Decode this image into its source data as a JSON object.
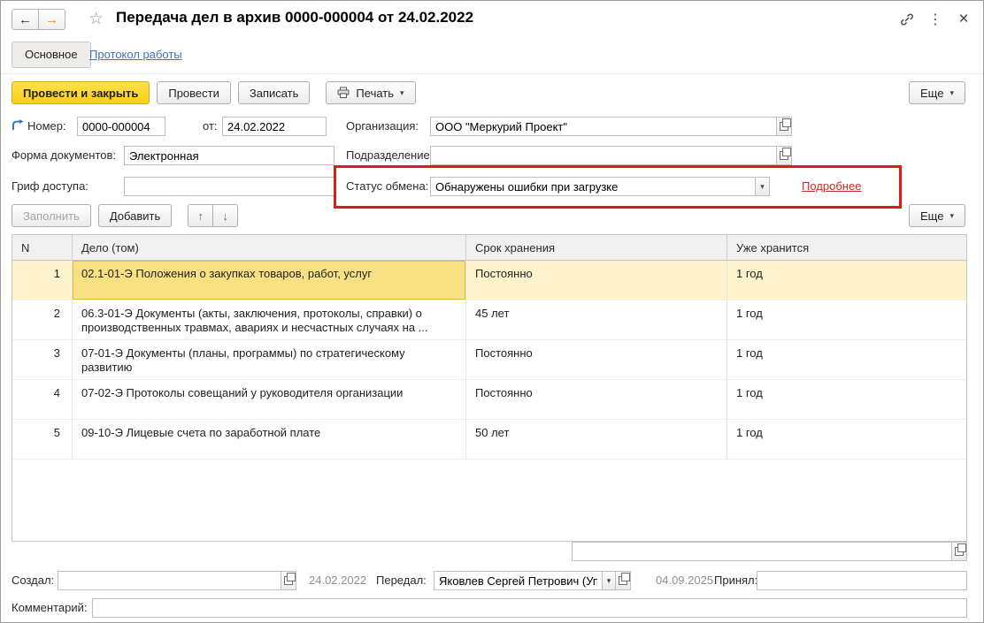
{
  "window": {
    "title": "Передача дел в архив 0000-000004 от 24.02.2022"
  },
  "icons": {
    "back": "←",
    "forward": "→",
    "star": "☆",
    "menu": "⋮",
    "close": "×",
    "caret": "▾",
    "up": "↑",
    "down": "↓"
  },
  "tabs": {
    "main": "Основное",
    "protocol": "Протокол работы"
  },
  "toolbar": {
    "post_and_close": "Провести и закрыть",
    "post": "Провести",
    "write": "Записать",
    "print": "Печать",
    "more": "Еще"
  },
  "fields": {
    "number_label": "Номер:",
    "number_value": "0000-000004",
    "from_label": "от:",
    "date_value": "24.02.2022",
    "org_label": "Организация:",
    "org_value": "ООО \"Меркурий Проект\"",
    "doc_form_label": "Форма документов:",
    "doc_form_value": "Электронная",
    "department_label": "Подразделение:",
    "department_value": "",
    "access_label": "Гриф доступа:",
    "access_value": "",
    "status_label": "Статус обмена:",
    "status_value": "Обнаружены ошибки при загрузке",
    "details_link": "Подробнее"
  },
  "table_toolbar": {
    "fill": "Заполнить",
    "add": "Добавить",
    "more": "Еще"
  },
  "table": {
    "columns": [
      "N",
      "Дело (том)",
      "Срок хранения",
      "Уже хранится"
    ],
    "rows": [
      {
        "n": "1",
        "case": "02.1-01-Э Положения о закупках товаров, работ, услуг",
        "period": "Постоянно",
        "stored": "1 год"
      },
      {
        "n": "2",
        "case": "06.3-01-Э Документы (акты, заключения, протоколы, справки) о производственных травмах, авариях и несчастных случаях на ...",
        "period": "45 лет",
        "stored": "1 год"
      },
      {
        "n": "3",
        "case": "07-01-Э Документы (планы, программы) по стратегическому развитию",
        "period": "Постоянно",
        "stored": "1 год"
      },
      {
        "n": "4",
        "case": "07-02-Э Протоколы совещаний у руководителя организации",
        "period": "Постоянно",
        "stored": "1 год"
      },
      {
        "n": "5",
        "case": "09-10-Э Лицевые счета по заработной плате",
        "period": "50 лет",
        "stored": "1 год"
      }
    ]
  },
  "footer": {
    "unlabeled_value": "",
    "created_label": "Создал:",
    "created_value": "",
    "created_date": "24.02.2022",
    "transferred_label": "Передал:",
    "transferred_value": "Яковлев Сергей Петрович (Упра",
    "transferred_date": "04.09.2025",
    "accepted_label": "Принял:",
    "accepted_value": "",
    "comment_label": "Комментарий:",
    "comment_value": ""
  },
  "colors": {
    "accent_yellow": "#fccf14",
    "selected_row": "#fcf2cc",
    "selected_cell": "#f8e083",
    "error_red": "#dd1d15",
    "link_blue": "#3a74bb",
    "link_red": "#c92a21"
  }
}
